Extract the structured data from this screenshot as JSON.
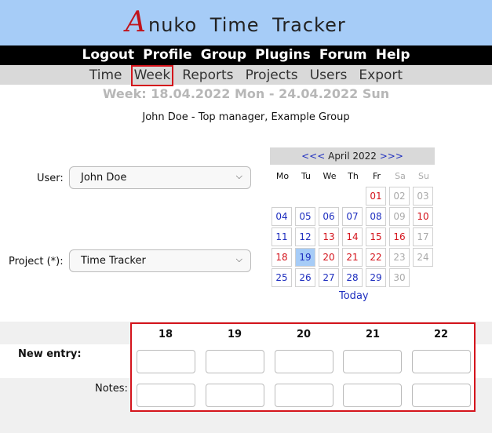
{
  "app": {
    "logo_letter": "A",
    "logo_rest": "nuko Time Tracker"
  },
  "topnav": [
    "Logout",
    "Profile",
    "Group",
    "Plugins",
    "Forum",
    "Help"
  ],
  "subnav": {
    "items": [
      "Time",
      "Week",
      "Reports",
      "Projects",
      "Users",
      "Export"
    ],
    "active": "Week"
  },
  "week_title": "Week: 18.04.2022 Mon - 24.04.2022 Sun",
  "user_line": "John Doe - Top manager, Example Group",
  "form": {
    "user_label": "User:",
    "user_value": "John Doe",
    "project_label": "Project (*):",
    "project_value": "Time Tracker"
  },
  "calendar": {
    "prev": "<<<",
    "month": "April 2022",
    "next": ">>>",
    "weekdays": [
      "Mo",
      "Tu",
      "We",
      "Th",
      "Fr",
      "Sa",
      "Su"
    ],
    "today_label": "Today",
    "selected_day": "19",
    "weeks": [
      [
        "",
        "",
        "",
        "",
        "01",
        "02",
        "03"
      ],
      [
        "04",
        "05",
        "06",
        "07",
        "08",
        "09",
        "10"
      ],
      [
        "11",
        "12",
        "13",
        "14",
        "15",
        "16",
        "17"
      ],
      [
        "18",
        "19",
        "20",
        "21",
        "22",
        "23",
        "24"
      ],
      [
        "25",
        "26",
        "27",
        "28",
        "29",
        "30",
        ""
      ]
    ]
  },
  "week_grid": {
    "days": [
      "18",
      "19",
      "20",
      "21",
      "22"
    ],
    "new_entry_label": "New entry:",
    "notes_label": "Notes:"
  },
  "colors": {
    "header": "#a6ccf7",
    "accent_red": "#d4141c",
    "link_blue": "#1f2fbf"
  }
}
